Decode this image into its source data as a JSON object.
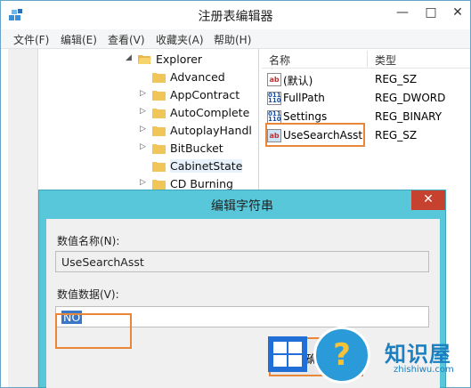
{
  "window": {
    "title": "注册表编辑器",
    "controls": {
      "minimize": "—",
      "maximize": "□",
      "close": "✕"
    }
  },
  "menu": [
    "文件(F)",
    "编辑(E)",
    "查看(V)",
    "收藏夹(A)",
    "帮助(H)"
  ],
  "tree": {
    "items": [
      {
        "label": "Explorer",
        "expanded": true
      },
      {
        "label": "Advanced"
      },
      {
        "label": "AppContract"
      },
      {
        "label": "AutoComplete"
      },
      {
        "label": "AutoplayHandl"
      },
      {
        "label": "BitBucket"
      },
      {
        "label": "CabinetState",
        "selected": true
      },
      {
        "label": "CD Burning"
      }
    ]
  },
  "list": {
    "headers": {
      "name": "名称",
      "type": "类型"
    },
    "rows": [
      {
        "name": "(默认)",
        "type": "REG_SZ",
        "icon": "ab"
      },
      {
        "name": "FullPath",
        "type": "REG_DWORD",
        "icon": "bin"
      },
      {
        "name": "Settings",
        "type": "REG_BINARY",
        "icon": "bin"
      },
      {
        "name": "UseSearchAsst",
        "type": "REG_SZ",
        "icon": "ab"
      }
    ]
  },
  "dialog": {
    "title": "编辑字符串",
    "close": "✕",
    "name_label": "数值名称(N):",
    "name_value": "UseSearchAsst",
    "data_label": "数值数据(V):",
    "data_value": "NO",
    "ok_label": "确定"
  },
  "watermark": {
    "brand": "知识屋",
    "site": "zhishiwu.com",
    "glyph": "?"
  },
  "colors": {
    "highlight_border": "#e8873a",
    "dialog_frame": "#58c7d9",
    "selection": "#3b77c9"
  }
}
